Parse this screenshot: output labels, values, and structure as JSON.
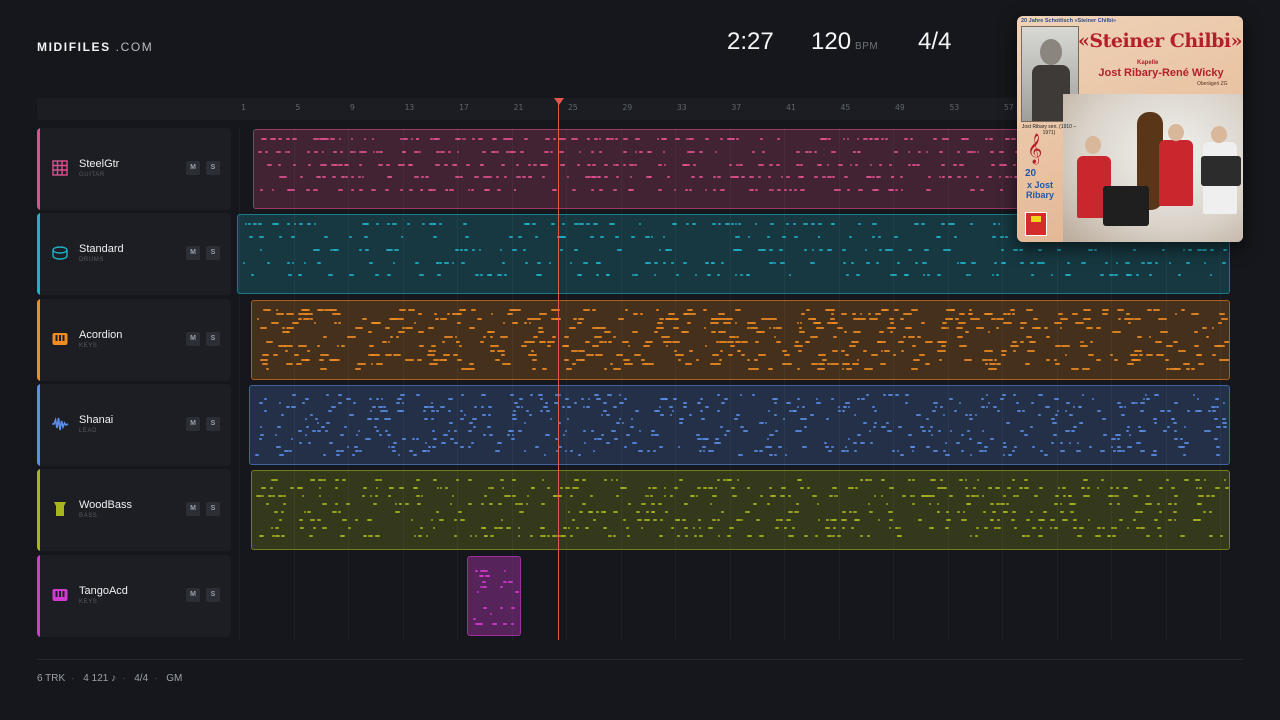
{
  "brand": {
    "name": "MIDIFILES",
    "domain": ".COM"
  },
  "transport": {
    "time": "2:27",
    "tempo": "120",
    "tempo_unit": "BPM",
    "meter": "4/4"
  },
  "ruler": {
    "bars": [
      "1",
      "5",
      "9",
      "13",
      "17",
      "21",
      "25",
      "29",
      "33",
      "37",
      "41",
      "45",
      "49",
      "53",
      "57"
    ]
  },
  "playhead": {
    "bar": 25
  },
  "tracks": [
    {
      "name": "SteelGtr",
      "type": "GUITAR",
      "color": "#e0508f",
      "icon": "guitar-grid-icon",
      "mute": "M",
      "solo": "S"
    },
    {
      "name": "Standard",
      "type": "DRUMS",
      "color": "#1fb1c8",
      "icon": "drum-icon",
      "mute": "M",
      "solo": "S"
    },
    {
      "name": "Acordion",
      "type": "KEYS",
      "color": "#f08c22",
      "icon": "keyboard-icon",
      "mute": "M",
      "solo": "S"
    },
    {
      "name": "Shanai",
      "type": "LEAD",
      "color": "#5a8ee8",
      "icon": "waveform-icon",
      "mute": "M",
      "solo": "S"
    },
    {
      "name": "WoodBass",
      "type": "BASS",
      "color": "#a7b51e",
      "icon": "bass-icon",
      "mute": "M",
      "solo": "S"
    },
    {
      "name": "TangoAcd",
      "type": "KEYS",
      "color": "#d23ad0",
      "icon": "keyboard-icon",
      "mute": "M",
      "solo": "S"
    }
  ],
  "album": {
    "top_tag": "20 Jahre Schottisch «Steiner Chilbi»",
    "title": "«Steiner Chilbi»",
    "kapelle": "Kapelle",
    "artist": "Jost Ribary-René Wicky",
    "place": "Oberägeri ZG",
    "life": "Jost Ribary sen. (1910 – 1971)",
    "n20": "20",
    "n20_sub": "x Jost Ribary"
  },
  "footer": {
    "tracks": "6 TRK",
    "notes": "4 121 ♪",
    "meter": "4/4",
    "standard": "GM"
  }
}
